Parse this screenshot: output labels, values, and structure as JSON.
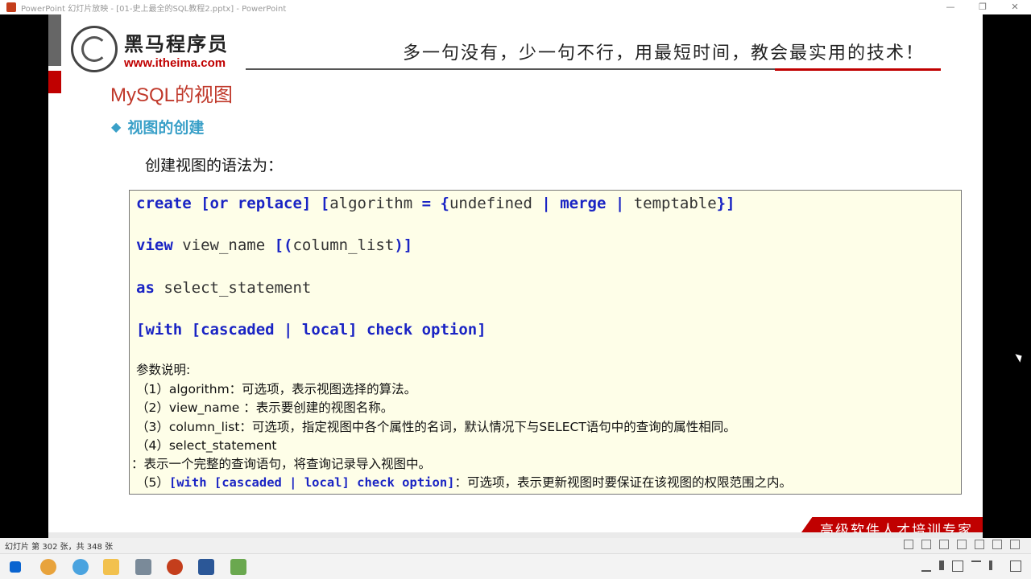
{
  "window": {
    "title": "PowerPoint 幻灯片放映 - [01-史上最全的SQL教程2.pptx] - PowerPoint",
    "minimize": "—",
    "restore": "❐",
    "close": "✕"
  },
  "slide": {
    "logo_name": "黑马程序员",
    "logo_url": "www.itheima.com",
    "slogan": "多一句没有，少一句不行，用最短时间，教会最实用的技术！",
    "title": "MySQL的视图",
    "subheading": "视图的创建",
    "intro": "创建视图的语法为：",
    "code": {
      "l1_kw1": "create [or replace] [",
      "l1_tx1": "algorithm ",
      "l1_kw2": "= {",
      "l1_tx2": "undefined ",
      "l1_kw3": "| merge | ",
      "l1_tx3": "temptable",
      "l1_kw4": "}]",
      "l2_kw1": "view ",
      "l2_tx1": "view_name ",
      "l2_kw2": "[(",
      "l2_tx2": "column_list",
      "l2_kw3": ")]",
      "l3_kw1": "as ",
      "l3_tx1": "select_statement",
      "l4_kw1": "[with [cascaded | local] check option]"
    },
    "notes": {
      "heading": "参数说明:",
      "n1": "（1）algorithm：可选项，表示视图选择的算法。",
      "n2": "（2）view_name ：表示要创建的视图名称。",
      "n3": "（3）column_list：可选项，指定视图中各个属性的名词，默认情况下与SELECT语句中的查询的属性相同。",
      "n4": "（4）select_statement",
      "n4b": "：表示一个完整的查询语句，将查询记录导入视图中。",
      "n5_prefix": "（5）",
      "n5_code": "[with [cascaded | local] check option]",
      "n5_suffix": "：可选项，表示更新视图时要保证在该视图的权限范围之内。"
    },
    "footer_badge": "高级软件人才培训专家"
  },
  "status": {
    "slide_counter": "幻灯片 第 302 张，共 348 张"
  },
  "colors": {
    "accent_red": "#c00000",
    "keyword_blue": "#1a24c4",
    "subhead_cyan": "#3aa0c8",
    "code_bg": "#fefee8"
  }
}
